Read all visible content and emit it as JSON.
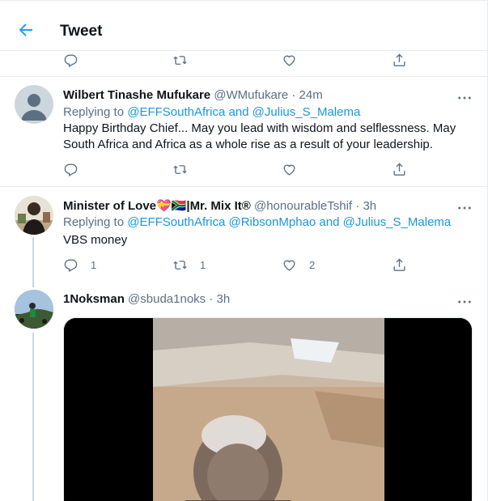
{
  "header": {
    "title": "Tweet"
  },
  "top_actions": {},
  "tweets": [
    {
      "name": "Wilbert Tinashe Mufukare",
      "handle": "@WMufukare",
      "time": "· 24m",
      "replying_prefix": "Replying to",
      "replying_to": "@EFFSouthAfrica and @Julius_S_Malema",
      "text_line1": "Happy Birthday Chief... May you lead with wisdom and selflessness. May",
      "text_line2": "South Africa and Africa as a whole rise as a result of your leadership."
    },
    {
      "name": "Minister of Love💝🇿🇦|Mr. Mix It®",
      "handle": "@honourableTshif",
      "time": "· 3h",
      "replying_prefix": "Replying to",
      "replying_to": "@EFFSouthAfrica @RibsonMphao and @Julius_S_Malema",
      "text_line1": "VBS money",
      "reply_count": "1",
      "retweet_count": "1",
      "like_count": "2"
    },
    {
      "name": "1Noksman",
      "handle": "@sbuda1noks",
      "time": "· 3h"
    }
  ],
  "icons": {
    "back": "arrow-left-icon",
    "reply": "comment-bubble-icon",
    "retweet": "retweet-icon",
    "like": "heart-icon",
    "share": "share-icon",
    "more": "more-dots-icon"
  },
  "colors": {
    "accent": "#1da1f2",
    "link": "#1b95e0",
    "muted": "#5b7083",
    "border": "#e6ecf0"
  }
}
